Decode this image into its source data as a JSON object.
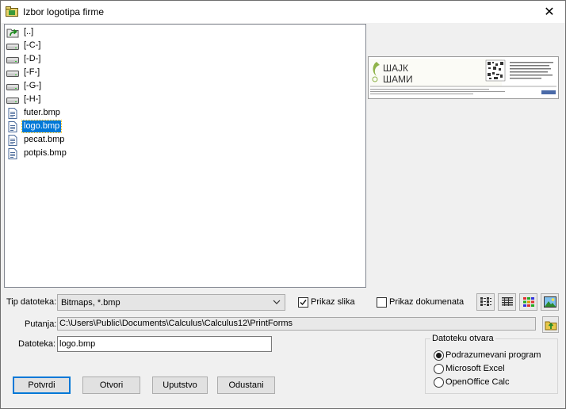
{
  "window": {
    "title": "Izbor logotipa firme",
    "close_glyph": "✕"
  },
  "filelist": {
    "items": [
      {
        "label": "[..]",
        "icon": "up-folder-icon"
      },
      {
        "label": "[-C-]",
        "icon": "drive-icon"
      },
      {
        "label": "[-D-]",
        "icon": "drive-icon"
      },
      {
        "label": "[-F-]",
        "icon": "drive-icon"
      },
      {
        "label": "[-G-]",
        "icon": "drive-icon"
      },
      {
        "label": "[-H-]",
        "icon": "drive-icon"
      },
      {
        "label": "futer.bmp",
        "icon": "file-icon"
      },
      {
        "label": "logo.bmp",
        "icon": "file-icon",
        "selected": true
      },
      {
        "label": "pecat.bmp",
        "icon": "file-icon"
      },
      {
        "label": "potpis.bmp",
        "icon": "file-icon"
      }
    ]
  },
  "preview": {
    "logo_text_1": "ШАЈК",
    "logo_text_2": "ШАМИ"
  },
  "filter": {
    "label": "Tip datoteka:",
    "value": "Bitmaps, *.bmp",
    "show_images_label": "Prikaz slika",
    "show_images_checked": true,
    "show_docs_label": "Prikaz dokumenata",
    "show_docs_checked": false
  },
  "view_buttons": [
    "list-view-icon",
    "details-view-icon",
    "thumbnails-view-icon",
    "image-view-icon"
  ],
  "path": {
    "label": "Putanja:",
    "value": "C:\\Users\\Public\\Documents\\Calculus\\Calculus12\\PrintForms"
  },
  "filename": {
    "label": "Datoteka:",
    "value": "logo.bmp"
  },
  "open_with": {
    "title": "Datoteku otvara",
    "options": [
      "Podrazumevani program",
      "Microsoft Excel",
      "OpenOffice Calc"
    ],
    "selected": 0
  },
  "buttons": {
    "confirm": "Potvrdi",
    "open": "Otvori",
    "help": "Uputstvo",
    "cancel": "Odustani"
  },
  "colors": {
    "selection": "#0078d7",
    "accent_green": "#2e9b2e"
  }
}
